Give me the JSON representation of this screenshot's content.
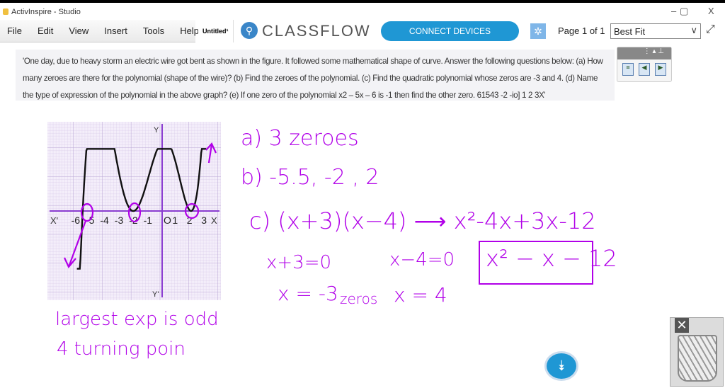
{
  "window": {
    "title": "ActivInspire - Studio",
    "minimize": "–",
    "restore": "▢",
    "close": "X"
  },
  "menu": [
    "File",
    "Edit",
    "View",
    "Insert",
    "Tools",
    "Help"
  ],
  "document_tab": "Untitled¹",
  "brand": "CLASSFLOW",
  "toolbar": {
    "connect": "CONNECT DEVICES",
    "page": "Page 1 of 1",
    "zoom": "Best Fit",
    "accent": "#1f97d4"
  },
  "question": "'One day, due to heavy storm an electric wire got bent as shown in the figure. It followed some mathematical shape of curve. Answer the following questions below: (a) How many zeroes are there for the polynomial (shape of the wire)? (b) Find the zeroes of the polynomial. (c) Find the quadratic polynomial whose zeros are -3 and 4. (d) Name the type of expression of the polynomial in the above graph? (e) If one zero of the polynomial x2 – 5x – 6 is -1 then find the other zero. 61543 -2 -io] 1 2 3X'",
  "graph": {
    "x_labels": [
      "-6",
      "-5",
      "-4",
      "-3",
      "-2",
      "-1",
      "O",
      "1",
      "2",
      "3"
    ],
    "x_axis": "X",
    "x_axis_neg": "X'",
    "y_axis": "Y",
    "y_axis_neg": "Y'"
  },
  "handwriting": {
    "a": "a) 3 zeroes",
    "b": "b) -5.5, -2 , 2",
    "c": "c)  (x+3)(x−4) ⟶ x²-4x+3x-12",
    "c_box": "x² − x − 12",
    "eq1": "x+3=0",
    "eq2": "x−4=0",
    "sol1": "x = -3",
    "zeros": "zeros",
    "sol2": "x = 4",
    "d1": "largest exp is odd",
    "d2": "4 turning poin",
    "ink_color": "#b100e8"
  }
}
